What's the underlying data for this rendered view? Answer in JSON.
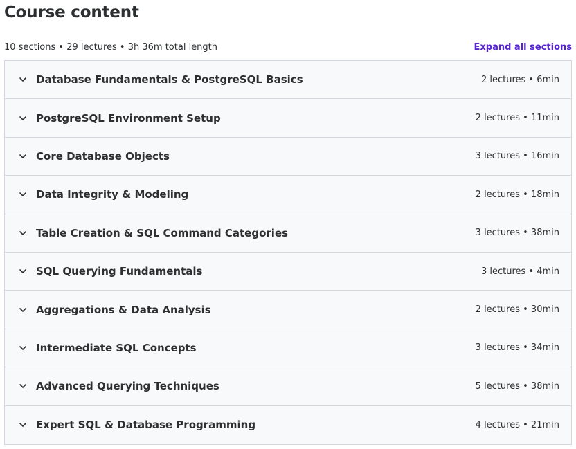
{
  "header": {
    "title": "Course content",
    "summary": "10 sections • 29 lectures • 3h 36m total length",
    "expand_all_label": "Expand all sections"
  },
  "sections": [
    {
      "title": "Database Fundamentals & PostgreSQL Basics",
      "meta": "2 lectures • 6min"
    },
    {
      "title": "PostgreSQL Environment Setup",
      "meta": "2 lectures • 11min"
    },
    {
      "title": "Core Database Objects",
      "meta": "3 lectures • 16min"
    },
    {
      "title": "Data Integrity & Modeling",
      "meta": "2 lectures • 18min"
    },
    {
      "title": "Table Creation & SQL Command Categories",
      "meta": "3 lectures • 38min"
    },
    {
      "title": "SQL Querying Fundamentals",
      "meta": "3 lectures • 4min"
    },
    {
      "title": "Aggregations & Data Analysis",
      "meta": "2 lectures • 30min"
    },
    {
      "title": "Intermediate SQL Concepts",
      "meta": "3 lectures • 34min"
    },
    {
      "title": "Advanced Querying Techniques",
      "meta": "5 lectures • 38min"
    },
    {
      "title": "Expert SQL & Database Programming",
      "meta": "4 lectures • 21min"
    }
  ],
  "colors": {
    "accent": "#5624d0",
    "text": "#2d2f31",
    "row_background": "#f7f9fa",
    "border": "#d1d7dc"
  },
  "icons": {
    "section_toggle": "chevron-down-icon"
  }
}
